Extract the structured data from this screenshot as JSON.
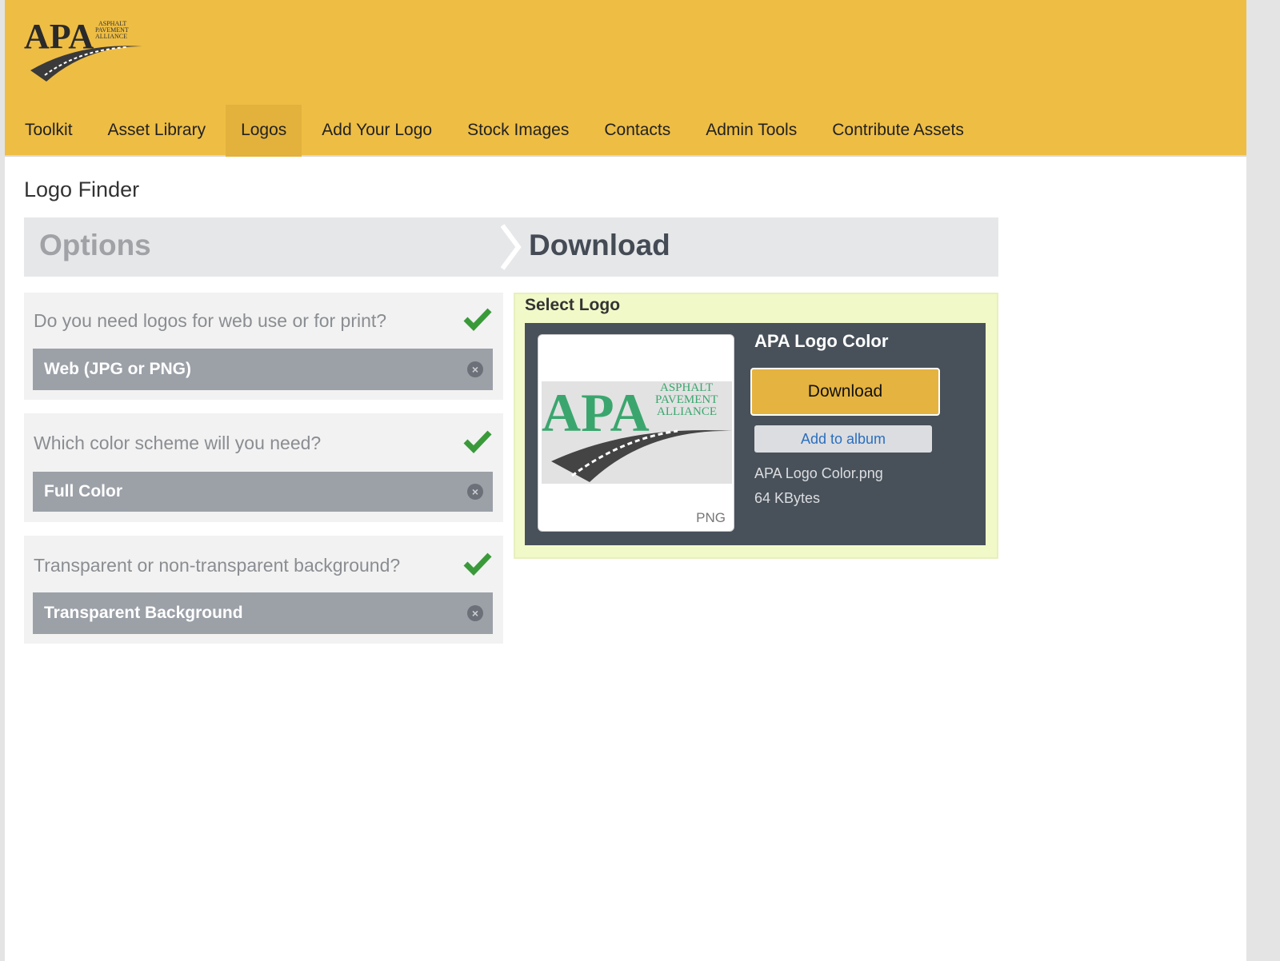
{
  "header": {
    "logo_text": "APA",
    "logo_subtext": "ASPHALT PAVEMENT ALLIANCE"
  },
  "nav": [
    {
      "label": "Toolkit"
    },
    {
      "label": "Asset Library"
    },
    {
      "label": "Logos",
      "active": true
    },
    {
      "label": "Add Your Logo"
    },
    {
      "label": "Stock Images"
    },
    {
      "label": "Contacts"
    },
    {
      "label": "Admin Tools"
    },
    {
      "label": "Contribute Assets"
    }
  ],
  "page_title": "Logo Finder",
  "steps": {
    "options": "Options",
    "download": "Download"
  },
  "questions": [
    {
      "question": "Do you need logos for web use or for print?",
      "answer": "Web (JPG or PNG)"
    },
    {
      "question": "Which color scheme will you need?",
      "answer": "Full Color"
    },
    {
      "question": "Transparent or non-transparent background?",
      "answer": "Transparent Background"
    }
  ],
  "select_logo": {
    "heading": "Select Logo",
    "name": "APA Logo Color",
    "download_label": "Download",
    "album_label": "Add to album",
    "filename": "APA Logo Color.png",
    "size": "64 KBytes",
    "format": "PNG",
    "thumb_text": "APA",
    "thumb_subtext": "ASPHALT PAVEMENT ALLIANCE"
  },
  "colors": {
    "header": "#eebd44",
    "accent_green": "#3a9a3a",
    "logo_green": "#3aa66e"
  }
}
